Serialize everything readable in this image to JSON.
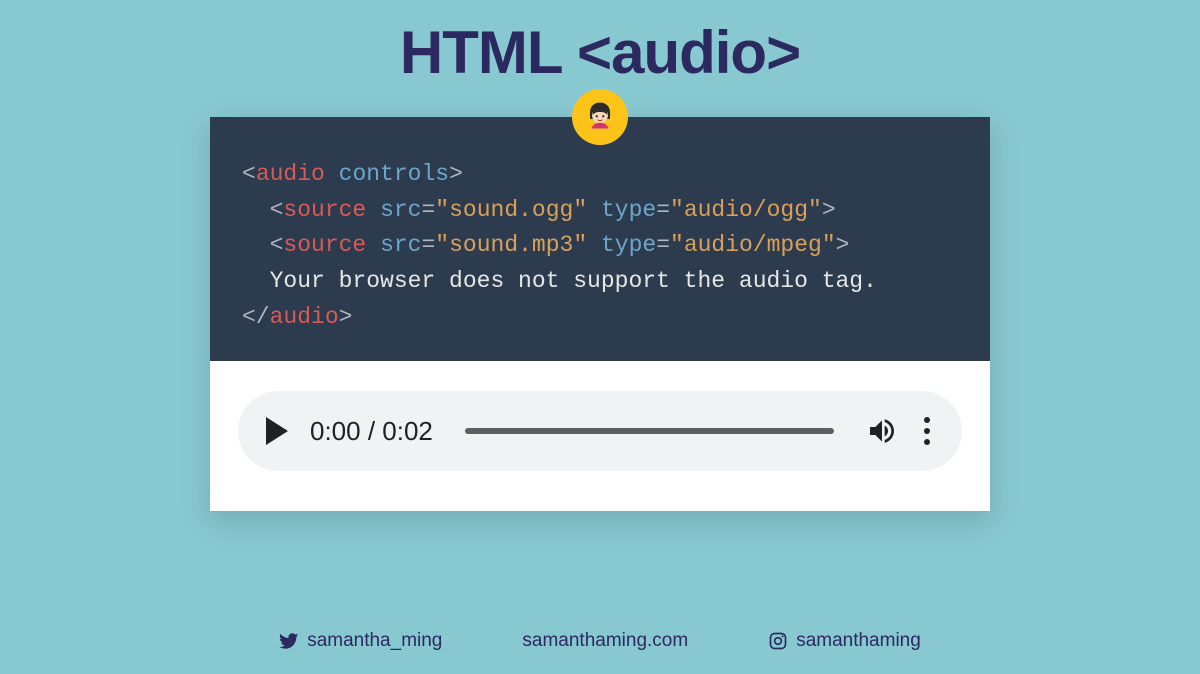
{
  "title": "HTML <audio>",
  "code": {
    "open_tag": {
      "name": "audio",
      "attr": "controls"
    },
    "sources": [
      {
        "tag": "source",
        "src_attr": "src",
        "src_val": "sound.ogg",
        "type_attr": "type",
        "type_val": "audio/ogg"
      },
      {
        "tag": "source",
        "src_attr": "src",
        "src_val": "sound.mp3",
        "type_attr": "type",
        "type_val": "audio/mpeg"
      }
    ],
    "fallback": "Your browser does not support the audio tag.",
    "close_tag": "audio"
  },
  "player": {
    "time": "0:00 / 0:02"
  },
  "footer": {
    "twitter": "samantha_ming",
    "site": "samanthaming.com",
    "instagram": "samanthaming"
  }
}
